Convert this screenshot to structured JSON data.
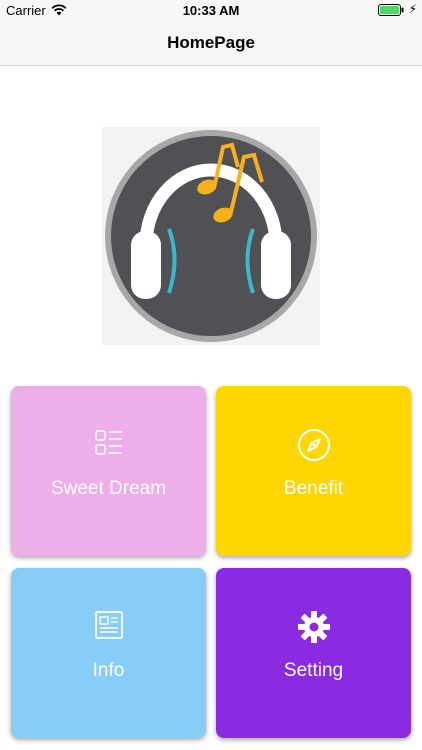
{
  "status_bar": {
    "carrier": "Carrier",
    "time": "10:33 AM",
    "battery_color": "#4cd964"
  },
  "nav": {
    "title": "HomePage"
  },
  "logo": {
    "icon": "headphones-music-icon",
    "colors": {
      "disc": "#505154",
      "ring": "#a7a7a7",
      "notes": "#f6b21b",
      "accent": "#3ab7cc"
    }
  },
  "tiles": [
    {
      "label": "Sweet Dream",
      "icon": "list-icon",
      "color": "#edaeea"
    },
    {
      "label": "Benefit",
      "icon": "compass-icon",
      "color": "#fed700"
    },
    {
      "label": "Info",
      "icon": "article-icon",
      "color": "#87cdf9"
    },
    {
      "label": "Setting",
      "icon": "gear-icon",
      "color": "#8a2be2"
    }
  ]
}
